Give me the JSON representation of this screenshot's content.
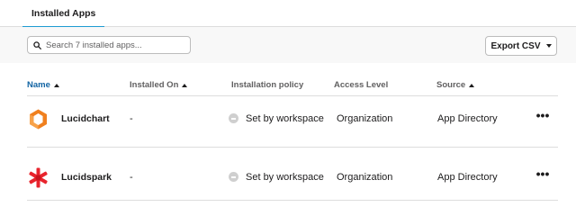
{
  "tabs": [
    {
      "label": "Installed Apps",
      "active": true
    }
  ],
  "search": {
    "placeholder": "Search 7 installed apps..."
  },
  "export_button": {
    "label": "Export CSV"
  },
  "columns": {
    "name": "Name",
    "installed_on": "Installed On",
    "installation_policy": "Installation policy",
    "access_level": "Access Level",
    "source": "Source"
  },
  "apps": [
    {
      "name": "Lucidchart",
      "icon": "lucidchart-logo",
      "installed_on": "-",
      "installation_policy": "Set by workspace",
      "access_level": "Organization",
      "source": "App Directory",
      "more": "•••"
    },
    {
      "name": "Lucidspark",
      "icon": "lucidspark-logo",
      "installed_on": "-",
      "installation_policy": "Set by workspace",
      "access_level": "Organization",
      "source": "App Directory",
      "more": "•••"
    }
  ],
  "colors": {
    "active_tab_underline": "#1d9bd1",
    "active_column": "#1264a3",
    "lucidchart_orange": "#f0801e",
    "lucidspark_red": "#e8242d"
  }
}
